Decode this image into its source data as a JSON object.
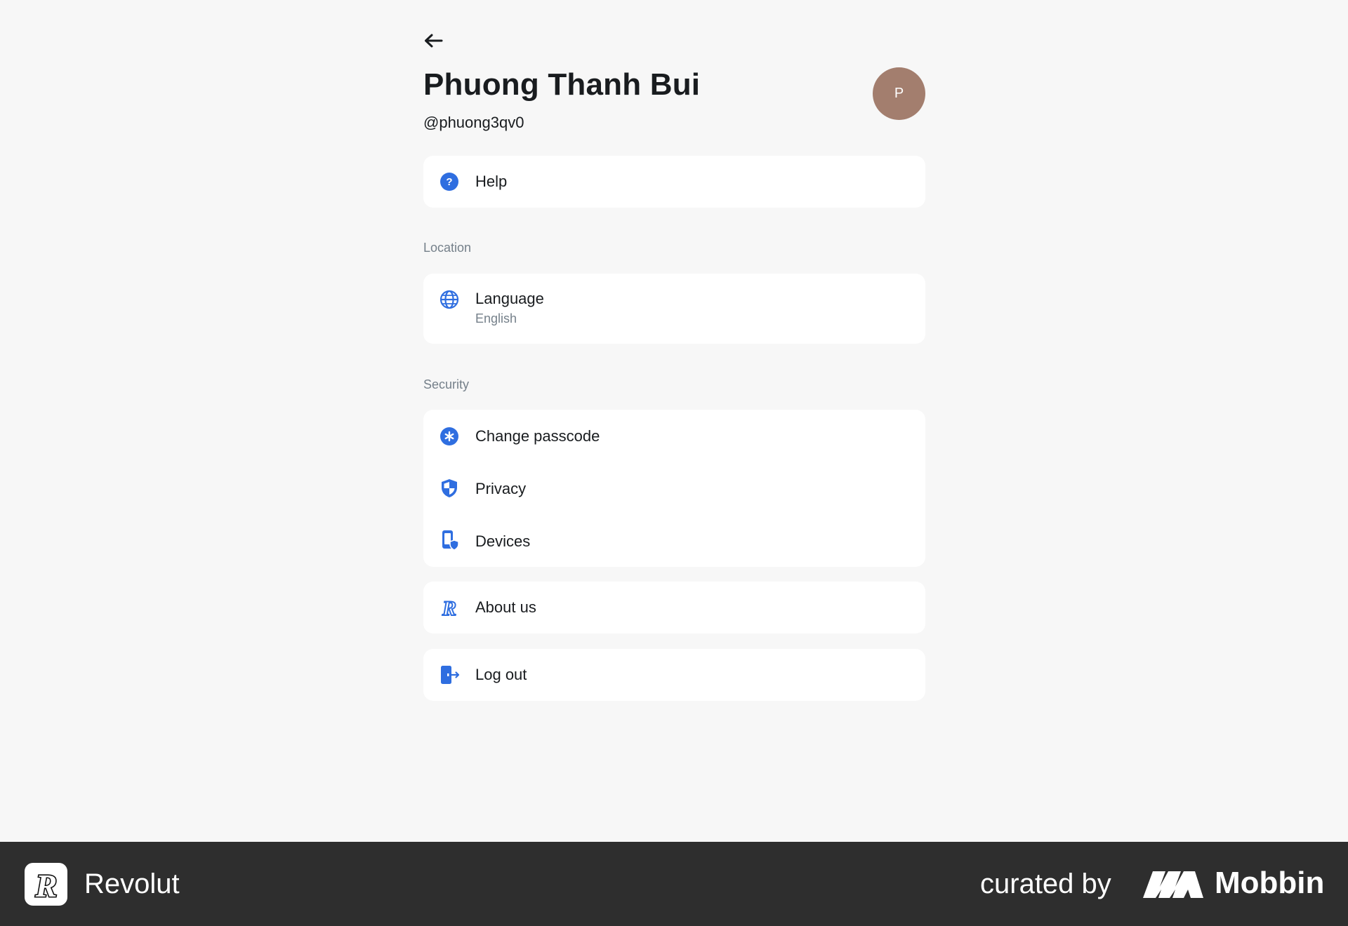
{
  "profile": {
    "name": "Phuong Thanh Bui",
    "handle": "@phuong3qv0",
    "avatar_initial": "P",
    "avatar_color": "#a37e6e"
  },
  "help": {
    "label": "Help"
  },
  "location": {
    "title": "Location",
    "language": {
      "label": "Language",
      "value": "English"
    }
  },
  "security": {
    "title": "Security",
    "items": [
      {
        "label": "Change passcode",
        "icon": "asterisk-icon"
      },
      {
        "label": "Privacy",
        "icon": "shield-icon"
      },
      {
        "label": "Devices",
        "icon": "device-shield-icon"
      }
    ]
  },
  "about": {
    "label": "About us"
  },
  "logout": {
    "label": "Log out"
  },
  "footer": {
    "brand": "Revolut",
    "curated_by": "curated by",
    "curator": "Mobbin"
  },
  "colors": {
    "accent": "#2f6ee0",
    "background": "#f7f7f7",
    "card": "#ffffff",
    "footer": "#2e2e2e",
    "secondary_text": "#75808a"
  }
}
